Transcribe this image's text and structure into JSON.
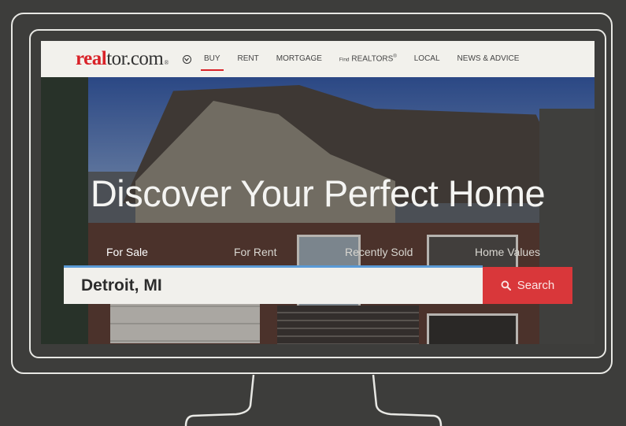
{
  "logo": {
    "red_part": "real",
    "dark_part": "tor.com",
    "trademark": "®"
  },
  "nav": {
    "items": [
      {
        "label": "BUY",
        "active": true
      },
      {
        "label": "RENT"
      },
      {
        "label": "MORTGAGE"
      },
      {
        "prefix": "Find",
        "label": "REALTORS",
        "sup": "®"
      },
      {
        "label": "LOCAL"
      },
      {
        "label": "NEWS & ADVICE"
      }
    ]
  },
  "hero": {
    "headline": "Discover Your Perfect Home"
  },
  "tabs": [
    {
      "label": "For Sale",
      "selected": true
    },
    {
      "label": "For Rent"
    },
    {
      "label": "Recently Sold"
    },
    {
      "label": "Home Values"
    }
  ],
  "search": {
    "value": "Detroit, MI",
    "button_label": "Search",
    "icon": "search-icon"
  },
  "colors": {
    "brand_red": "#d92228",
    "search_button": "#d9373a",
    "input_accent": "#5a9ad6"
  }
}
